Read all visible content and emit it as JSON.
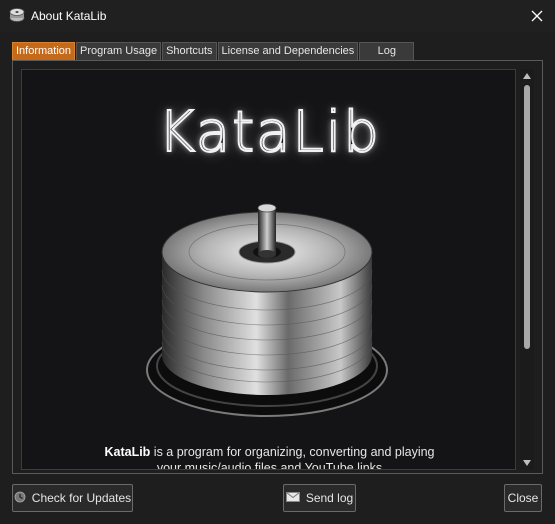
{
  "window": {
    "title": "About KataLib"
  },
  "tabs": [
    {
      "label": "Information",
      "active": true
    },
    {
      "label": "Program Usage",
      "active": false
    },
    {
      "label": "Shortcuts",
      "active": false
    },
    {
      "label": "License and Dependencies",
      "active": false
    },
    {
      "label": "Log",
      "active": false
    }
  ],
  "content": {
    "logo_text": "KataLib",
    "description_bold": "KataLib",
    "description_line1_rest": " is a program for organizing, converting and playing",
    "description_line2": "your music/audio files and YouTube links"
  },
  "buttons": {
    "check_updates": "Check for Updates",
    "send_log": "Send log",
    "close": "Close"
  },
  "colors": {
    "accent": "#c5691a",
    "background": "#1e1e1e",
    "content_bg": "#141416"
  },
  "icons": [
    "app-icon",
    "close-icon",
    "disc-stack-image",
    "update-icon",
    "mail-icon",
    "scroll-up-icon",
    "scroll-down-icon"
  ]
}
